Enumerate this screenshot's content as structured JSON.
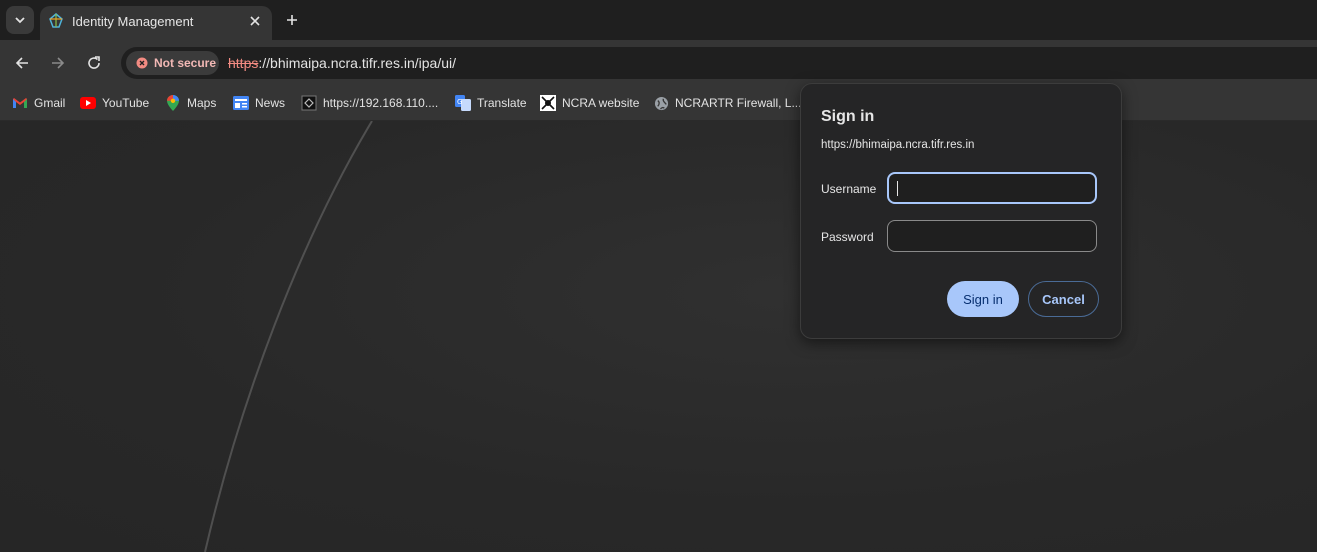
{
  "tab": {
    "title": "Identity Management",
    "favicon": "freeipa-icon"
  },
  "toolbar": {
    "security_label": "Not secure",
    "url_scheme": "https",
    "url_rest": "://bhimaipa.ncra.tifr.res.in/ipa/ui/"
  },
  "bookmarks": [
    {
      "label": "Gmail",
      "icon": "gmail-icon"
    },
    {
      "label": "YouTube",
      "icon": "youtube-icon"
    },
    {
      "label": "Maps",
      "icon": "maps-icon"
    },
    {
      "label": "News",
      "icon": "news-icon"
    },
    {
      "label": "https://192.168.110....",
      "icon": "site-icon"
    },
    {
      "label": "Translate",
      "icon": "translate-icon"
    },
    {
      "label": "NCRA website",
      "icon": "ncra-icon"
    },
    {
      "label": "NCRARTR Firewall, L...",
      "icon": "globe-icon"
    }
  ],
  "dialog": {
    "title": "Sign in",
    "origin": "https://bhimaipa.ncra.tifr.res.in",
    "username_label": "Username",
    "username_value": "",
    "password_label": "Password",
    "password_value": "",
    "signin_label": "Sign in",
    "cancel_label": "Cancel"
  },
  "colors": {
    "accent": "#a8c7fa",
    "not_secure": "#f28b82"
  }
}
